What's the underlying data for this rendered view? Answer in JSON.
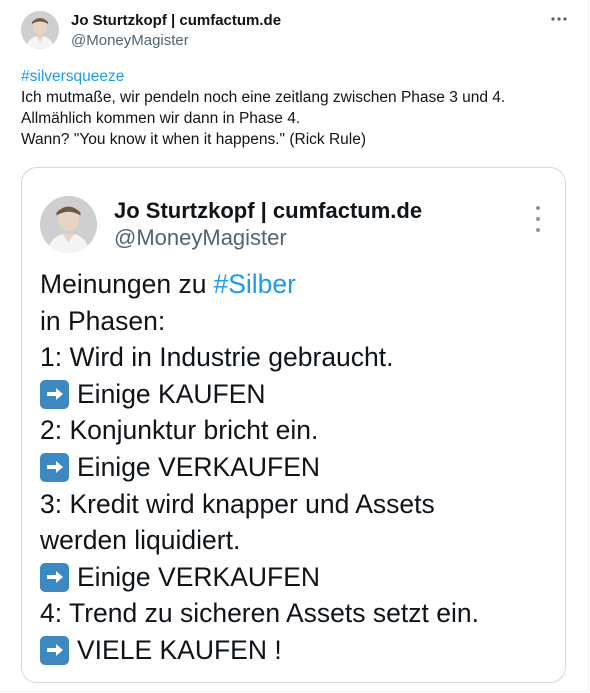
{
  "tweet": {
    "author_name": "Jo Sturtzkopf | cumfactum.de",
    "author_handle": "@MoneyMagister",
    "more_icon": "more-horizontal-icon",
    "hashtag": "#silversqueeze",
    "lines": [
      "Ich mutmaße, wir pendeln noch eine zeitlang zwischen Phase 3 und 4.",
      "Allmählich kommen wir dann in Phase 4.",
      "Wann? \"You know it when it happens.\" (Rick Rule)"
    ]
  },
  "quoted": {
    "author_name": "Jo Sturtzkopf | cumfactum.de",
    "author_handle": "@MoneyMagister",
    "more_icon": "more-vertical-icon",
    "title_prefix": "Meinungen zu",
    "title_hashtag": "#Silber",
    "lines": [
      "in Phasen:",
      "1: Wird in Industrie gebraucht.",
      "Einige KAUFEN",
      "2: Konjunktur bricht ein.",
      "Einige VERKAUFEN",
      "3: Kredit wird knapper und Assets",
      "werden liquidiert.",
      "Einige VERKAUFEN",
      "4: Trend zu sicheren Assets setzt ein.",
      "VIELE KAUFEN !"
    ],
    "arrow_icon": "right-arrow-emoji-icon"
  },
  "colors": {
    "link": "#1d9bf0",
    "text": "#0f1419",
    "secondary": "#536471",
    "border": "#cfd9de",
    "emoji_bg": "#3b88c3"
  }
}
